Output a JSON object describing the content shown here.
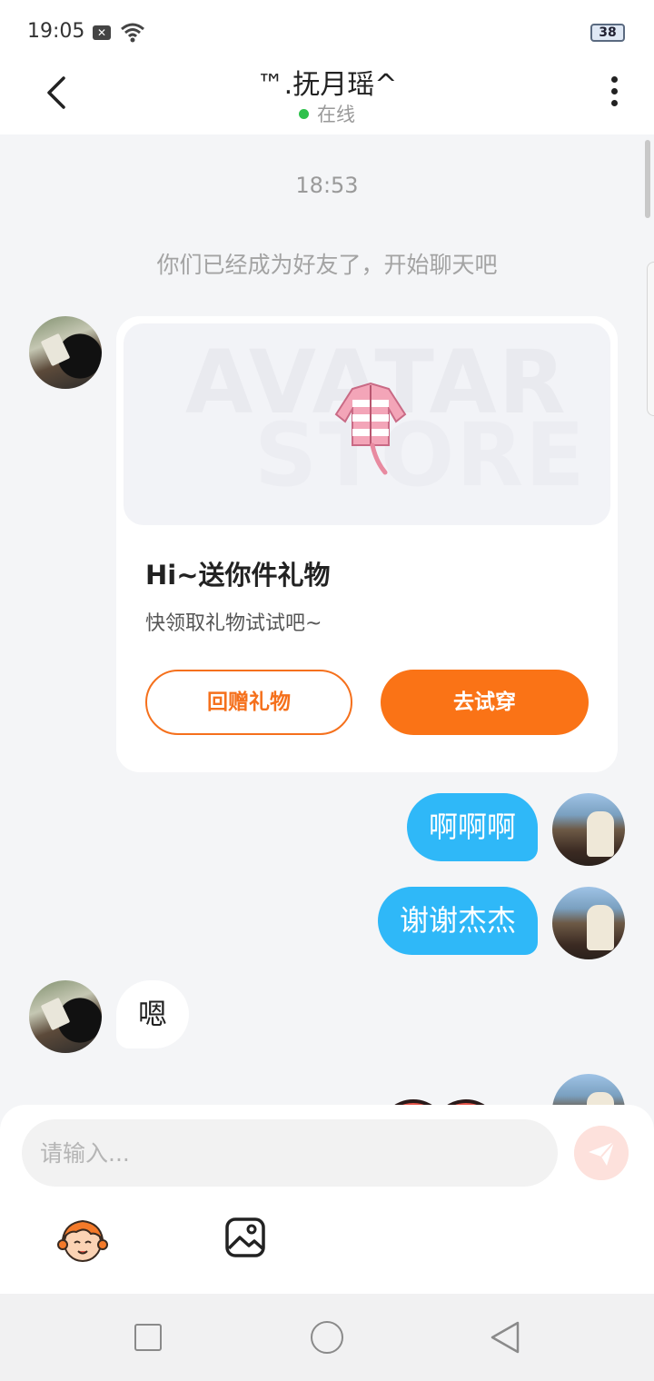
{
  "status_bar": {
    "time": "19:05",
    "battery": "38"
  },
  "header": {
    "title": "™.抚月瑶^",
    "status": "在线"
  },
  "chat": {
    "time_label": "18:53",
    "system_message": "你们已经成为好友了，开始聊天吧",
    "gift_card": {
      "brand_line1": "AVATAR",
      "brand_line2": "STORE",
      "title": "Hi~送你件礼物",
      "description": "快领取礼物试试吧~",
      "return_button": "回赠礼物",
      "try_button": "去试穿"
    },
    "messages": [
      {
        "side": "right",
        "text": "啊啊啊"
      },
      {
        "side": "right",
        "text": "谢谢杰杰"
      },
      {
        "side": "left",
        "text": "嗯"
      }
    ]
  },
  "composer": {
    "placeholder": "请输入..."
  },
  "colors": {
    "accent_orange": "#fa7316",
    "bubble_blue": "#2fb8f8",
    "online_green": "#2ec14b"
  }
}
